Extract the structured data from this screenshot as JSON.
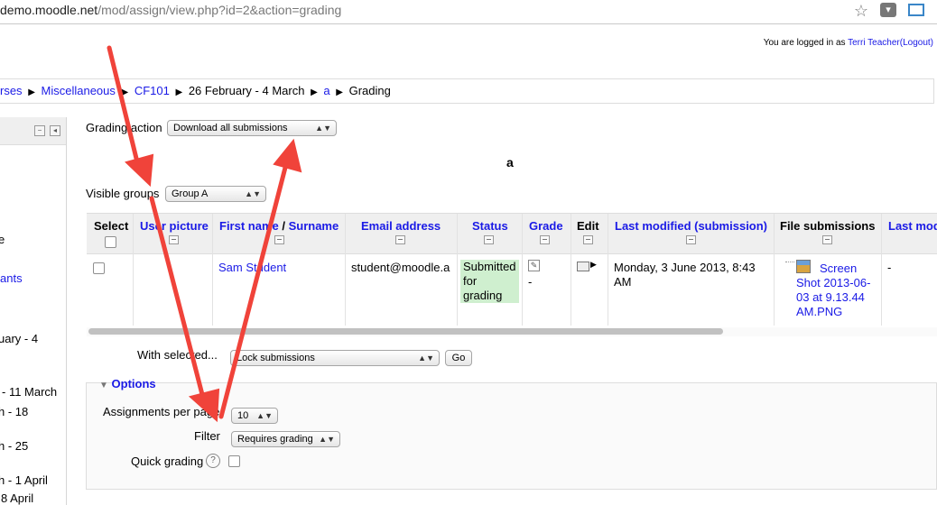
{
  "browser": {
    "url_host": "demo.moodle.net",
    "url_path": "/mod/assign/view.php?id=2&action=grading",
    "star_icon": "star-icon",
    "pocket_icon": "pocket-icon",
    "resize_icon": "window-resize-icon"
  },
  "login": {
    "prefix": "You are logged in as",
    "user": "Terri Teacher",
    "logout": "(Logout)"
  },
  "breadcrumb": {
    "items": [
      "rses",
      "Miscellaneous",
      "CF101",
      "26 February - 4 March",
      "a",
      "Grading"
    ],
    "separator": "▶"
  },
  "left_block": {
    "items": [
      "e",
      "ants",
      "uary - 4",
      "- 11 March",
      "h - 18",
      "h - 25",
      "h - 1 April",
      "8 April"
    ]
  },
  "grading": {
    "action_label": "Grading action",
    "action_value": "Download all submissions",
    "assignment_title": "a",
    "groups_label": "Visible groups",
    "groups_value": "Group A"
  },
  "table": {
    "headers": {
      "select": "Select",
      "user_picture": "User picture",
      "first_name": "First name",
      "name_sep": " / ",
      "surname": "Surname",
      "email": "Email address",
      "status": "Status",
      "grade": "Grade",
      "edit": "Edit",
      "last_modified": "Last modified (submission)",
      "file_submissions": "File submissions",
      "last_mod_cut": "Last mod"
    },
    "row": {
      "name": "Sam Student",
      "email": "student@moodle.a",
      "status_lines": [
        "Submitted",
        "for",
        "grading"
      ],
      "grade": "-",
      "last_modified_lines": [
        "Monday, 3 June 2013, 8:43",
        "AM"
      ],
      "file_lines": [
        "Screen",
        "Shot 2013-06-",
        "03 at 9.13.44",
        "AM.PNG"
      ],
      "last_col": "-"
    }
  },
  "bulk": {
    "label": "With selected...",
    "value": "Lock submissions",
    "go": "Go"
  },
  "options": {
    "legend": "Options",
    "per_page_label": "Assignments per page",
    "per_page_value": "10",
    "filter_label": "Filter",
    "filter_value": "Requires grading",
    "quick_label": "Quick grading",
    "help_icon": "help-icon"
  },
  "colors": {
    "link": "#1a1ae6",
    "status_bg": "#cfefcf",
    "arrow": "#f0433a"
  }
}
